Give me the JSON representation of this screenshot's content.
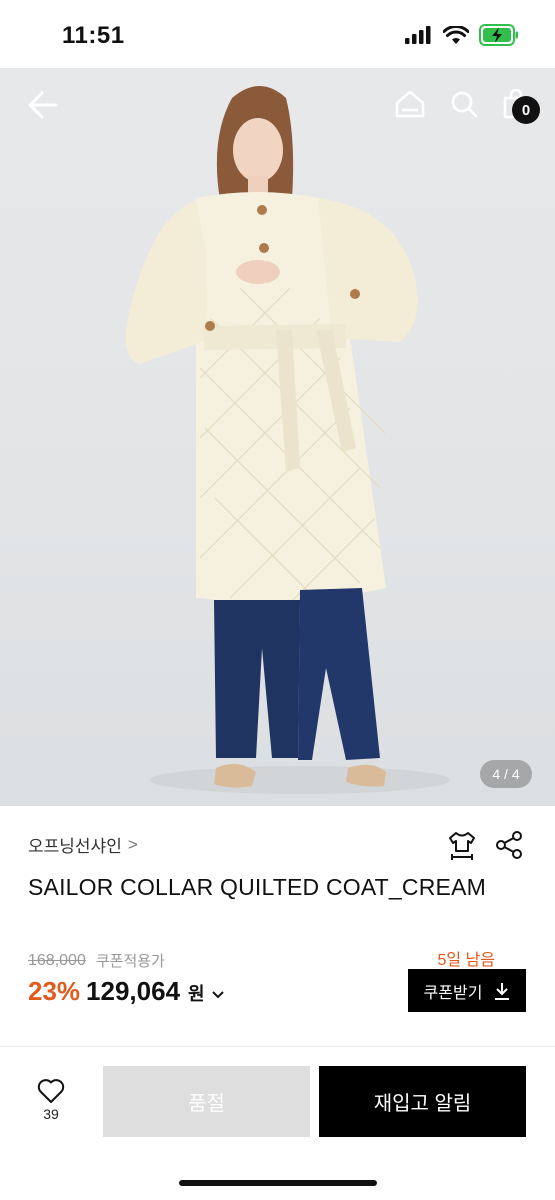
{
  "status_bar": {
    "time": "11:51"
  },
  "hero": {
    "pager": "4 / 4",
    "cart_count": "0"
  },
  "product": {
    "brand": "오프닝선샤인",
    "brand_chevron": ">",
    "title": "SAILOR COLLAR QUILTED COAT_CREAM",
    "original_price": "168,000",
    "coupon_label": "쿠폰적용가",
    "discount": "23%",
    "price": "129,064",
    "currency": "원",
    "days_left": "5일 남음",
    "coupon_button": "쿠폰받기"
  },
  "bottom_bar": {
    "like_count": "39",
    "sold_out_label": "품절",
    "restock_label": "재입고 알림"
  },
  "icons": {
    "back": "arrow-left-icon",
    "home": "home-icon",
    "search": "search-icon",
    "bag": "shopping-bag-icon",
    "size": "shirt-size-icon",
    "share": "share-icon",
    "download": "download-icon",
    "heart": "heart-icon"
  },
  "colors": {
    "accent": "#e25b1e",
    "primary": "#000000",
    "disabled": "#dedede"
  }
}
